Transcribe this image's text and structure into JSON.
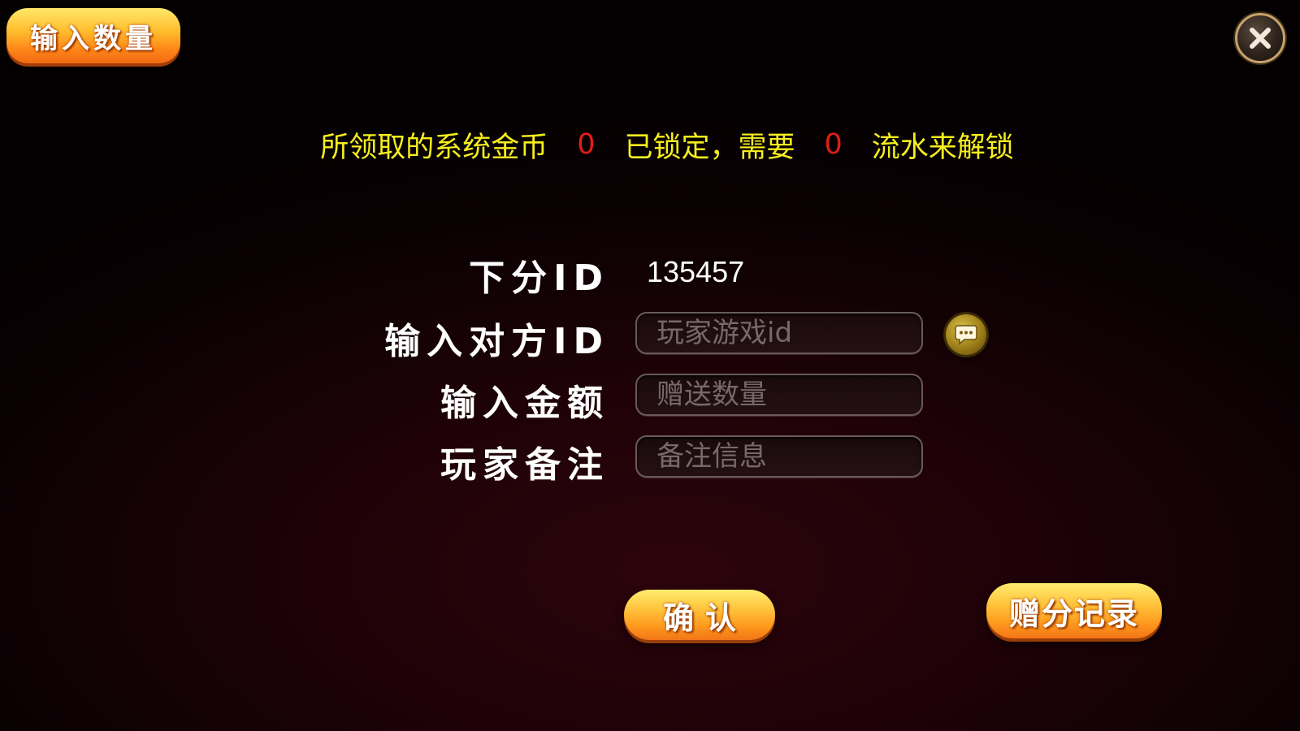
{
  "header": {
    "title": "输入数量",
    "close_icon": "close-icon"
  },
  "notice": {
    "part1": "所领取的系统金币",
    "locked_coins": "0",
    "part2": "已锁定，需要",
    "required_turnover": "0",
    "part3": "流水来解锁"
  },
  "form": {
    "own_id": {
      "label": "下分ID",
      "value": "135457"
    },
    "target_id": {
      "label": "输入对方ID",
      "placeholder": "玩家游戏id",
      "value": ""
    },
    "amount": {
      "label": "输入金额",
      "placeholder": "赠送数量",
      "value": ""
    },
    "remark": {
      "label": "玩家备注",
      "placeholder": "备注信息",
      "value": ""
    },
    "chat_icon": "chat-bubble-icon"
  },
  "buttons": {
    "confirm": "确认",
    "gift_record": "赠分记录"
  },
  "colors": {
    "notice_text": "#f6ee1d",
    "notice_number": "#e11d16",
    "button_orange": "#ff9a1e",
    "background": "#1c0207"
  }
}
